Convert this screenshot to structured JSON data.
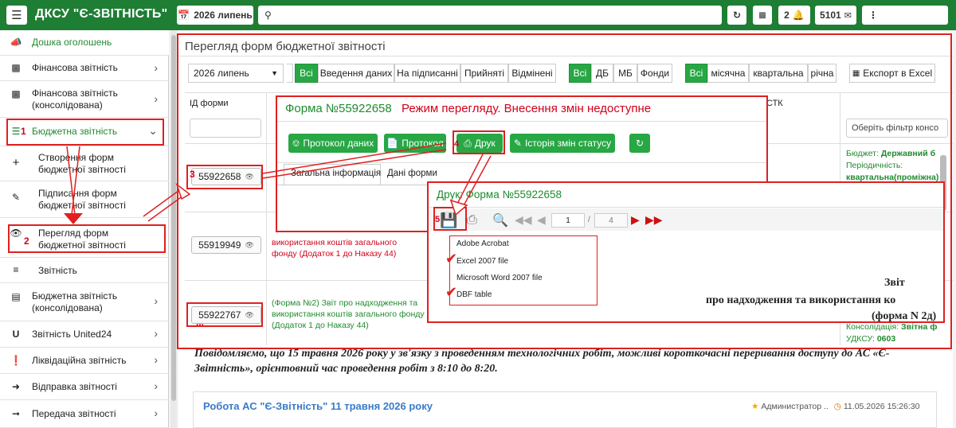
{
  "header": {
    "title": "ДКСУ \"Є-ЗВІТНІСТЬ\"",
    "period": "2026 липень",
    "counter_bell": "2",
    "counter_mail": "5101"
  },
  "sidebar": {
    "items": [
      {
        "label": "Дошка оголошень"
      },
      {
        "label": "Фінансова звітність"
      },
      {
        "label": "Фінансова звітність (консолідована)"
      },
      {
        "label": "Бюджетна звітність",
        "marker": "1"
      },
      {
        "label": "Створення форм бюджетної звітності"
      },
      {
        "label": "Підписання форм бюджетної звітності"
      },
      {
        "label": "Перегляд форм бюджетної звітності",
        "marker": "2"
      },
      {
        "label": "Звітність"
      },
      {
        "label": "Бюджетна звітність (консолідована)"
      },
      {
        "label": "Звітність United24"
      },
      {
        "label": "Ліквідаційна звітність"
      },
      {
        "label": "Відправка звітності"
      },
      {
        "label": "Передача звітності"
      }
    ]
  },
  "main": {
    "page_title": "Перегляд форм бюджетної звітності",
    "period_select": "2026 липень",
    "status_filters": [
      "Всі",
      "Введення даних",
      "На підписанні",
      "Прийняті",
      "Відмінені"
    ],
    "type_filters": [
      "Всі",
      "ДБ",
      "МБ",
      "Фонди"
    ],
    "freq_filters": [
      "Всі",
      "місячна",
      "квартальна",
      "річна"
    ],
    "export_label": "Експорт в Excel",
    "col_id": "ІД форми",
    "col_stk": "СТК",
    "filter_placeholder": "Оберіть фільтр консо",
    "rows": [
      {
        "id": "55922658",
        "marker": "3"
      },
      {
        "id": "55919949",
        "desc": "використання коштів загального фонду (Додаток 1 до Наказу 44)"
      },
      {
        "id": "55922767",
        "marker": "...",
        "desc": "(Форма №2) Звіт про надходження та використання коштів загального фонду (Додаток 1 до Наказу 44)"
      }
    ],
    "right_info": {
      "budget_label": "Бюджет: ",
      "budget_value": "Державний б",
      "period_label": "Періодичність:",
      "period_value": "квартальна(проміжна)",
      "consol_label": "Консолідація: ",
      "consol_value": "Звітна ф",
      "udksu_label": "УДКСУ: ",
      "udksu_value": "0603"
    },
    "notice": "Повідомляємо, що 15 травня 2026 року у зв'язку з проведенням технологічних робіт, можливі короткочасні переривання доступу до АС «Є-Звітність», орієнтовний час проведення робіт з 8:10 до 8:20.",
    "news": {
      "title": "Робота АС \"Є-Звітність\" 11 травня 2026 року",
      "author": "Администратор ..",
      "date": "11.05.2026 15:26:30"
    }
  },
  "form_panel": {
    "title": "Форма №55922658",
    "mode_text": "Режим перегляду. Внесення змін недоступне",
    "buttons": [
      "Протокол даних",
      "Протокол",
      "Друк",
      "Історія змін статусу"
    ],
    "marker": "4",
    "tabs": [
      "Загальна інформація",
      "Дані форми"
    ]
  },
  "print_panel": {
    "title": "Друк: Форма №55922658",
    "page": "1",
    "page_sep": "/",
    "total": "4",
    "marker": "5",
    "export_options": [
      "Adobe Acrobat",
      "Excel 2007 file",
      "Microsoft Word 2007 file",
      "DBF table"
    ],
    "preview_line1": "Звіт",
    "preview_line2": "про надходження та використання ко",
    "preview_line3": "(форма N 2д)"
  },
  "colors": {
    "brand": "#1e7e34",
    "accent_green": "#28a745",
    "annotation_red": "#e02020"
  }
}
